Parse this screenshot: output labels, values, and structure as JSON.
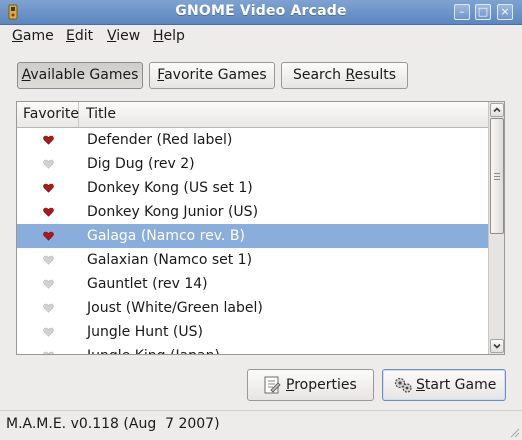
{
  "window": {
    "title": "GNOME Video Arcade",
    "minimize_glyph": "–",
    "maximize_glyph": "□",
    "close_glyph": "×"
  },
  "menu": [
    {
      "pre": "",
      "u": "G",
      "post": "ame"
    },
    {
      "pre": "",
      "u": "E",
      "post": "dit"
    },
    {
      "pre": "",
      "u": "V",
      "post": "iew"
    },
    {
      "pre": "",
      "u": "H",
      "post": "elp"
    }
  ],
  "tabs": [
    {
      "pre": "",
      "u": "A",
      "post": "vailable Games",
      "active": true
    },
    {
      "pre": "",
      "u": "F",
      "post": "avorite Games",
      "active": false
    },
    {
      "pre": "Search ",
      "u": "R",
      "post": "esults",
      "active": false
    }
  ],
  "list": {
    "columns": {
      "favorite": "Favorite",
      "title": "Title"
    },
    "rows": [
      {
        "title": "Defender (Red label)",
        "favorite": true,
        "selected": false
      },
      {
        "title": "Dig Dug (rev 2)",
        "favorite": false,
        "selected": false
      },
      {
        "title": "Donkey Kong (US set 1)",
        "favorite": true,
        "selected": false
      },
      {
        "title": "Donkey Kong Junior (US)",
        "favorite": true,
        "selected": false
      },
      {
        "title": "Galaga (Namco rev. B)",
        "favorite": true,
        "selected": true
      },
      {
        "title": "Galaxian (Namco set 1)",
        "favorite": false,
        "selected": false
      },
      {
        "title": "Gauntlet (rev 14)",
        "favorite": false,
        "selected": false
      },
      {
        "title": "Joust (White/Green label)",
        "favorite": false,
        "selected": false
      },
      {
        "title": "Jungle Hunt (US)",
        "favorite": false,
        "selected": false
      },
      {
        "title": "Jungle King (Japan)",
        "favorite": false,
        "selected": false
      }
    ]
  },
  "actions": {
    "properties": {
      "pre": "",
      "u": "P",
      "post": "roperties",
      "icon": "properties-icon"
    },
    "start_game": {
      "pre": "",
      "u": "S",
      "post": "tart Game",
      "icon": "gears-icon"
    }
  },
  "status": {
    "text": "M.A.M.E. v0.118 (Aug  7 2007)"
  },
  "colors": {
    "selection": "#8aaedc",
    "favorite_heart": "#b01818",
    "unfavorite_heart": "#d2d2d2",
    "titlebar": "#6a92c8"
  }
}
